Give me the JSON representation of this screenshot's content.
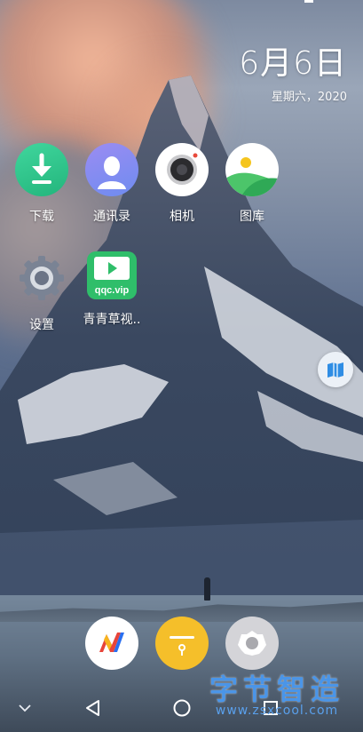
{
  "clock": {
    "date": "6月6日",
    "weekday": "星期六，2020"
  },
  "apps": [
    {
      "label": "下载",
      "icon": "download-icon"
    },
    {
      "label": "通讯录",
      "icon": "contacts-icon"
    },
    {
      "label": "相机",
      "icon": "camera-icon"
    },
    {
      "label": "图库",
      "icon": "gallery-icon"
    },
    {
      "label": "设置",
      "icon": "settings-icon"
    },
    {
      "label": "青青草视..",
      "icon": "qqc-video-icon",
      "icon_text": "qqc.vip"
    }
  ],
  "dock": [
    {
      "icon": "v-app-icon"
    },
    {
      "icon": "notes-icon"
    },
    {
      "icon": "gear-icon"
    }
  ],
  "floating_button": {
    "icon": "map-book-icon"
  },
  "navbar": {
    "buttons": [
      "collapse-icon",
      "back-icon",
      "home-icon",
      "recents-icon"
    ]
  },
  "watermark": {
    "title": "字节智造",
    "url": "www.zsxcool.com"
  },
  "colors": {
    "download": "#2ec68c",
    "contacts": "#8a8cf2",
    "dock_notes": "#f5bf2a",
    "watermark": "#4a95e8"
  }
}
